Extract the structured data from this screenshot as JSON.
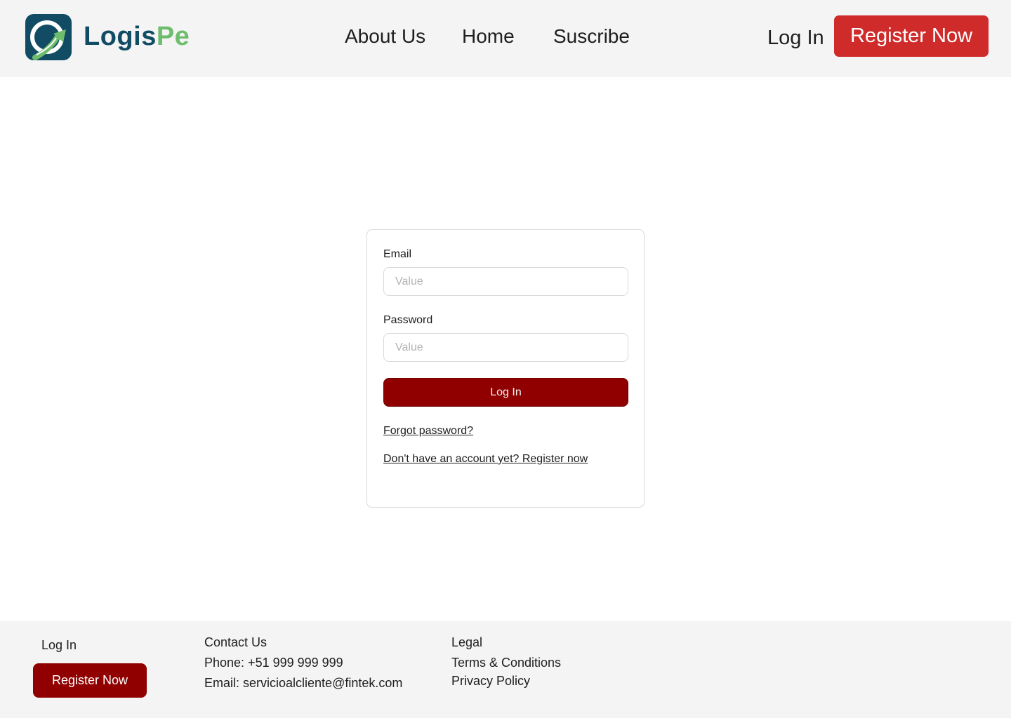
{
  "header": {
    "logo_icon": "logo-arrow-icon",
    "brand_part1": "Logis",
    "brand_part2": "Pe",
    "nav": [
      "About Us",
      "Home",
      "Suscribe"
    ],
    "login_label": "Log In",
    "register_label": "Register Now"
  },
  "login_form": {
    "email_label": "Email",
    "email_placeholder": "Value",
    "email_value": "",
    "password_label": "Password",
    "password_placeholder": "Value",
    "password_value": "",
    "submit_label": "Log In",
    "forgot_link": "Forgot password?",
    "register_link": "Don't have an account yet? Register now"
  },
  "footer": {
    "login_label": "Log In",
    "register_label": "Register Now",
    "contact_heading": "Contact Us",
    "phone": "Phone: +51 999 999 999",
    "email": "Email: servicioalcliente@fintek.com",
    "legal_heading": "Legal",
    "terms": "Terms & Conditions",
    "privacy": "Privacy Policy"
  },
  "colors": {
    "brand_dark": "#124c64",
    "brand_green": "#6dbd6d",
    "header_register": "#cf2b2b",
    "primary_button": "#900000",
    "header_bg": "#f4f4f4"
  }
}
